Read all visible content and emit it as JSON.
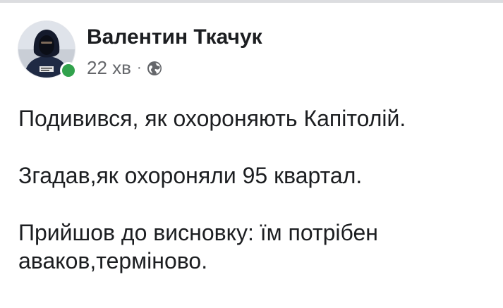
{
  "post": {
    "author": "Валентин Ткачук",
    "time": "22 хв",
    "separator": "·",
    "audience_icon": "globe-icon",
    "online_status_color": "#31a24c",
    "paragraphs": {
      "p1": "Подивився, як охороняють Капітолій.",
      "p2": "Згадав,як охороняли 95 квартал.",
      "p3": "Прийшов до висновку: їм потрібен аваков,терміново."
    }
  }
}
